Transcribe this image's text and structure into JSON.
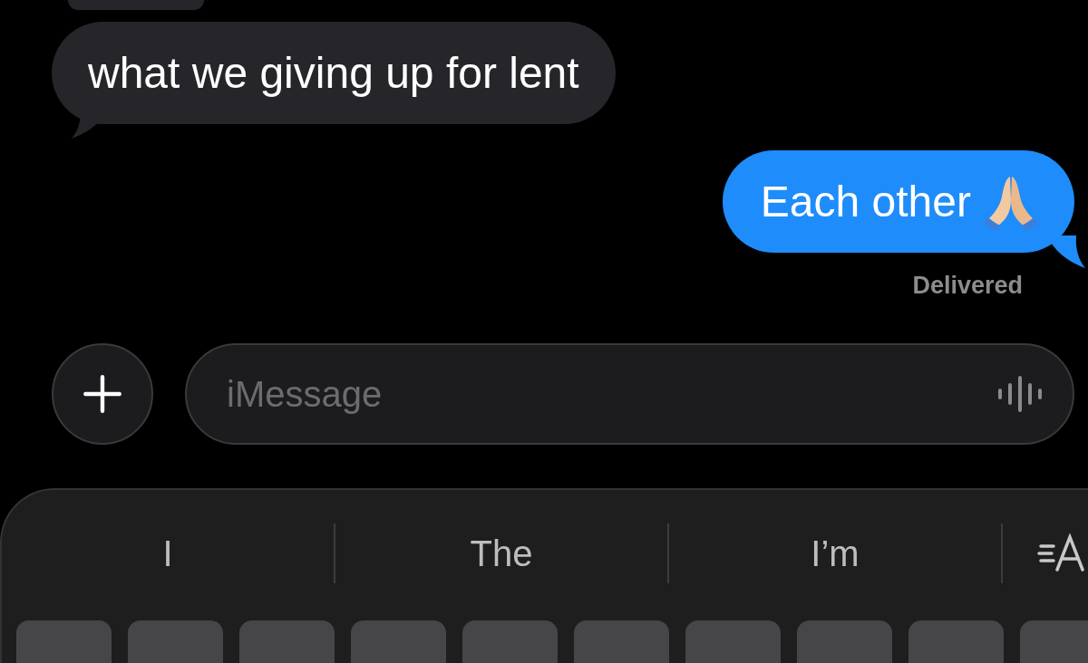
{
  "messages": [
    {
      "kind": "received_partial"
    },
    {
      "kind": "received",
      "text": "what we giving up for lent"
    },
    {
      "kind": "sent",
      "text": "Each other",
      "status": "Delivered"
    }
  ],
  "composer": {
    "placeholder": "iMessage"
  },
  "keyboard": {
    "suggestions": [
      "I",
      "The",
      "I’m"
    ]
  }
}
